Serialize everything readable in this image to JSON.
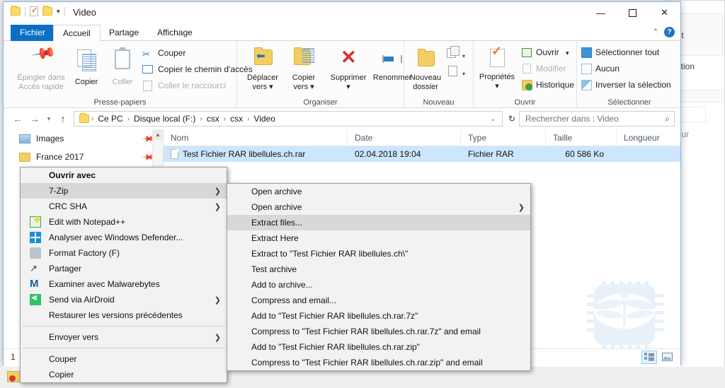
{
  "window": {
    "title": "Video",
    "quick_access_icons": [
      "folder-icon",
      "properties-icon",
      "folder-icon",
      "dropdown-caret-icon"
    ],
    "caption": {
      "minimize": "—",
      "maximize": "❐",
      "close": "✕"
    },
    "help_label": "?"
  },
  "tabs": [
    {
      "label": "Fichier",
      "kind": "file"
    },
    {
      "label": "Accueil",
      "kind": "active"
    },
    {
      "label": "Partage",
      "kind": "normal"
    },
    {
      "label": "Affichage",
      "kind": "normal"
    }
  ],
  "ribbon": {
    "groups": [
      {
        "label": "Presse-papiers"
      },
      {
        "label": "Organiser"
      },
      {
        "label": "Nouveau"
      },
      {
        "label": "Ouvrir"
      },
      {
        "label": "Sélectionner"
      }
    ],
    "clipboard": {
      "pin_line1": "Épingler dans",
      "pin_line2": "Accès rapide",
      "copy": "Copier",
      "paste": "Coller",
      "cut": "Couper",
      "copy_path": "Copier le chemin d'accès",
      "paste_shortcut": "Coller le raccourci"
    },
    "organize": {
      "move_to_l1": "Déplacer",
      "move_to_l2": "vers",
      "copy_to_l1": "Copier",
      "copy_to_l2": "vers",
      "delete": "Supprimer",
      "rename": "Renommer"
    },
    "new": {
      "new_folder_l1": "Nouveau",
      "new_folder_l2": "dossier"
    },
    "open": {
      "properties": "Propriétés",
      "open": "Ouvrir",
      "modify": "Modifier",
      "history": "Historique"
    },
    "select": {
      "select_all": "Sélectionner tout",
      "none": "Aucun",
      "invert": "Inverser la sélection"
    }
  },
  "addressbar": {
    "back": "←",
    "forward": "→",
    "recent": "▾",
    "up": "↑",
    "breadcrumbs": [
      "Ce PC",
      "Disque local (F:)",
      "csx",
      "csx",
      "Video"
    ],
    "separator": "›",
    "dropdown": "⌄",
    "refresh": "↻",
    "search_placeholder": "Rechercher dans : Video",
    "search_value": "",
    "search_icon": "search-icon"
  },
  "navpane": {
    "items": [
      {
        "label": "Images",
        "icon": "pictures-icon",
        "pinned": true
      },
      {
        "label": "France 2017",
        "icon": "folder-icon",
        "pinned": true
      }
    ]
  },
  "filelist": {
    "columns": [
      "Nom",
      "Date",
      "Type",
      "Taille",
      "Longueur"
    ],
    "rows": [
      {
        "name": "Test Fichier RAR libellules.ch.rar",
        "date": "02.04.2018 19:04",
        "type": "Fichier RAR",
        "size": "60 586 Ko",
        "length": ""
      }
    ]
  },
  "statusbar": {
    "text": "1",
    "view_details_icon": "details-view-icon",
    "view_thumbnails_icon": "thumbnail-view-icon"
  },
  "context_menu": {
    "items": [
      {
        "label": "Ouvrir avec",
        "bold": true,
        "submenu": false,
        "icon": null,
        "highlight": false
      },
      {
        "label": "7-Zip",
        "bold": false,
        "submenu": true,
        "icon": null,
        "highlight": true
      },
      {
        "label": "CRC SHA",
        "bold": false,
        "submenu": true,
        "icon": null,
        "highlight": false
      },
      {
        "label": "Edit with Notepad++",
        "bold": false,
        "submenu": false,
        "icon": "notepadpp-icon",
        "highlight": false
      },
      {
        "label": "Analyser avec Windows Defender...",
        "bold": false,
        "submenu": false,
        "icon": "windows-defender-icon",
        "highlight": false
      },
      {
        "label": "Format Factory (F)",
        "bold": false,
        "submenu": false,
        "icon": "format-factory-icon",
        "highlight": false
      },
      {
        "label": "Partager",
        "bold": false,
        "submenu": false,
        "icon": "share-icon",
        "highlight": false
      },
      {
        "label": "Examiner avec Malwarebytes",
        "bold": false,
        "submenu": false,
        "icon": "malwarebytes-icon",
        "highlight": false
      },
      {
        "label": "Send via AirDroid",
        "bold": false,
        "submenu": true,
        "icon": "airdroid-icon",
        "highlight": false
      },
      {
        "label": "Restaurer les versions précédentes",
        "bold": false,
        "submenu": false,
        "icon": null,
        "highlight": false
      },
      {
        "separator": true
      },
      {
        "label": "Envoyer vers",
        "bold": false,
        "submenu": true,
        "icon": null,
        "highlight": false
      },
      {
        "separator": true
      },
      {
        "label": "Couper",
        "bold": false,
        "submenu": false,
        "icon": null,
        "highlight": false
      },
      {
        "label": "Copier",
        "bold": false,
        "submenu": false,
        "icon": null,
        "highlight": false
      }
    ]
  },
  "submenu_7zip": {
    "items": [
      {
        "label": "Open archive",
        "submenu": false,
        "highlight": false
      },
      {
        "label": "Open archive",
        "submenu": true,
        "highlight": false
      },
      {
        "label": "Extract files...",
        "submenu": false,
        "highlight": true
      },
      {
        "label": "Extract Here",
        "submenu": false,
        "highlight": false
      },
      {
        "label": "Extract to \"Test Fichier RAR libellules.ch\\\"",
        "submenu": false,
        "highlight": false
      },
      {
        "label": "Test archive",
        "submenu": false,
        "highlight": false
      },
      {
        "label": "Add to archive...",
        "submenu": false,
        "highlight": false
      },
      {
        "label": "Compress and email...",
        "submenu": false,
        "highlight": false
      },
      {
        "label": "Add to \"Test Fichier RAR libellules.ch.rar.7z\"",
        "submenu": false,
        "highlight": false
      },
      {
        "label": "Compress to \"Test Fichier RAR libellules.ch.rar.7z\" and email",
        "submenu": false,
        "highlight": false
      },
      {
        "label": "Add to \"Test Fichier RAR libellules.ch.rar.zip\"",
        "submenu": false,
        "highlight": false
      },
      {
        "label": "Compress to \"Test Fichier RAR libellules.ch.rar.zip\" and email",
        "submenu": false,
        "highlight": false
      }
    ]
  },
  "background_window": {
    "fragment_1": "out",
    "fragment_2": "ection",
    "fragment_3": "r"
  },
  "colors": {
    "accent": "#0b6fc4",
    "selection": "#cce6ff",
    "menu_bg": "#f2f2f2",
    "menu_highlight": "#d8d8d8",
    "folder_yellow": "#f2ce63",
    "close_red": "#e81123"
  }
}
